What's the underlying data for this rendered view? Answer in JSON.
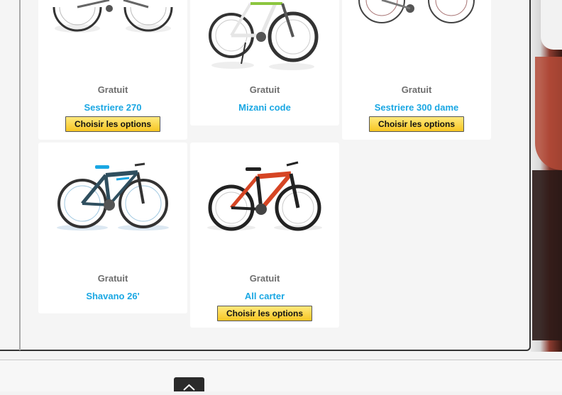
{
  "products": [
    {
      "price": "Gratuit",
      "name": "Sestriere 270",
      "button": "Choisir les options"
    },
    {
      "price": "Gratuit",
      "name": "Mizani code"
    },
    {
      "price": "Gratuit",
      "name": "Sestriere 300 dame",
      "button": "Choisir les options"
    },
    {
      "price": "Gratuit",
      "name": "Shavano 26'"
    },
    {
      "price": "Gratuit",
      "name": "All carter",
      "button": "Choisir les options"
    }
  ],
  "colors": {
    "link": "#1aa7e3",
    "button_top": "#ffe97d",
    "button_bottom": "#f7c623"
  },
  "icons": {
    "back_to_top": "chevron-up-icon"
  }
}
